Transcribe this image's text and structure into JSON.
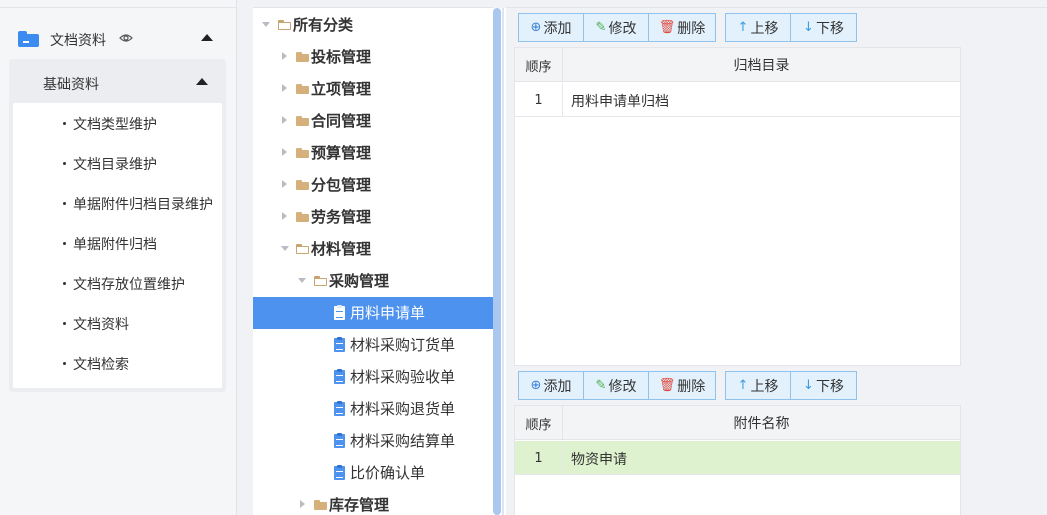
{
  "nav": {
    "section_label": "文档资料",
    "sub_label": "基础资料",
    "items": [
      {
        "label": "文档类型维护"
      },
      {
        "label": "文档目录维护"
      },
      {
        "label": "单据附件归档目录维护"
      },
      {
        "label": "单据附件归档"
      },
      {
        "label": "文档存放位置维护"
      },
      {
        "label": "文档资料"
      },
      {
        "label": "文档检索"
      }
    ]
  },
  "tree": {
    "nodes": [
      {
        "label": "所有分类",
        "level": 0,
        "kind": "folder-open",
        "arrow": "down"
      },
      {
        "label": "投标管理",
        "level": 1,
        "kind": "folder",
        "arrow": "right"
      },
      {
        "label": "立项管理",
        "level": 1,
        "kind": "folder",
        "arrow": "right"
      },
      {
        "label": "合同管理",
        "level": 1,
        "kind": "folder",
        "arrow": "right"
      },
      {
        "label": "预算管理",
        "level": 1,
        "kind": "folder",
        "arrow": "right"
      },
      {
        "label": "分包管理",
        "level": 1,
        "kind": "folder",
        "arrow": "right"
      },
      {
        "label": "劳务管理",
        "level": 1,
        "kind": "folder",
        "arrow": "right"
      },
      {
        "label": "材料管理",
        "level": 1,
        "kind": "folder-open",
        "arrow": "down"
      },
      {
        "label": "采购管理",
        "level": 2,
        "kind": "folder-open",
        "arrow": "down"
      },
      {
        "label": "用料申请单",
        "level": 3,
        "kind": "doc",
        "selected": true
      },
      {
        "label": "材料采购订货单",
        "level": 3,
        "kind": "doc"
      },
      {
        "label": "材料采购验收单",
        "level": 3,
        "kind": "doc"
      },
      {
        "label": "材料采购退货单",
        "level": 3,
        "kind": "doc"
      },
      {
        "label": "材料采购结算单",
        "level": 3,
        "kind": "doc"
      },
      {
        "label": "比价确认单",
        "level": 3,
        "kind": "doc"
      },
      {
        "label": "库存管理",
        "level": 2,
        "kind": "folder",
        "arrow": "right"
      }
    ]
  },
  "toolbar": {
    "add": "添加",
    "edit": "修改",
    "delete": "删除",
    "up": "上移",
    "down": "下移"
  },
  "grid_top": {
    "col_seq": "顺序",
    "col_name": "归档目录",
    "rows": [
      {
        "seq": "1",
        "name": "用料申请单归档"
      }
    ]
  },
  "grid_bottom": {
    "col_seq": "顺序",
    "col_name": "附件名称",
    "rows": [
      {
        "seq": "1",
        "name": "物资申请"
      }
    ]
  },
  "colors": {
    "accent": "#4d92ee",
    "button_bg": "#e3f1fc",
    "button_border": "#8fc3ee",
    "row_highlight": "#dff2cf",
    "folder": "#d6b07a"
  },
  "icons": {
    "add": "plus-circle-icon",
    "edit": "pencil-icon",
    "delete": "trash-icon",
    "up": "arrow-up-icon",
    "down": "arrow-down-icon"
  }
}
